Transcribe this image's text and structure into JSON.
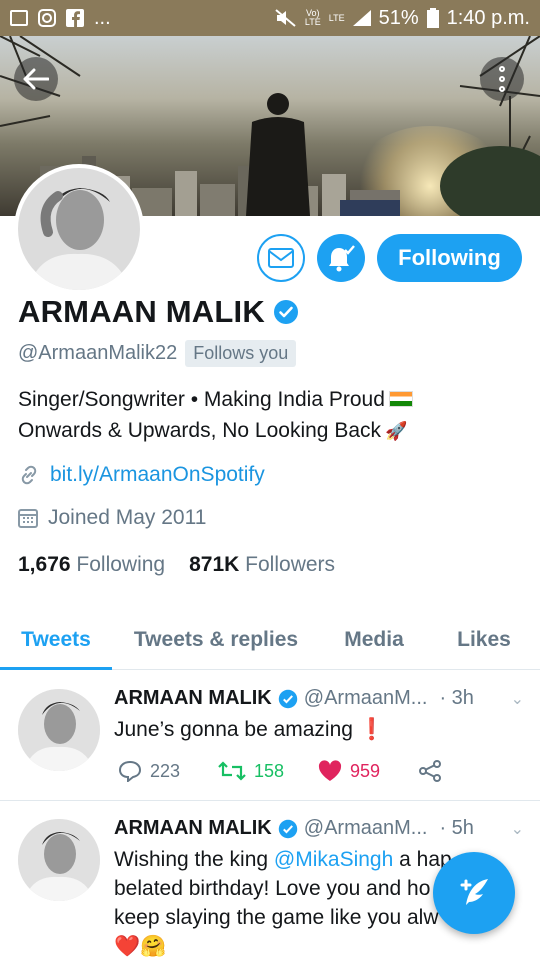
{
  "status_bar": {
    "left_icons": [
      "image-icon",
      "instagram-icon",
      "facebook-icon"
    ],
    "dots": "...",
    "battery": "51%",
    "time": "1:40 p.m.",
    "net_label_1": "Vo)",
    "net_label_2": "LTE",
    "net_label_3": "LTE"
  },
  "profile": {
    "name": "ARMAAN MALIK",
    "handle": "@ArmaanMalik22",
    "follows_you": "Follows you",
    "bio_line1": "Singer/Songwriter • Making India Proud",
    "bio_line2": "Onwards & Upwards, No Looking Back",
    "link": "bit.ly/ArmaanOnSpotify",
    "joined": "Joined May 2011",
    "following_count": "1,676",
    "following_label": "Following",
    "followers_count": "871K",
    "followers_label": "Followers",
    "follow_button": "Following"
  },
  "tabs": [
    {
      "label": "Tweets",
      "active": true
    },
    {
      "label": "Tweets & replies",
      "active": false
    },
    {
      "label": "Media",
      "active": false
    },
    {
      "label": "Likes",
      "active": false
    }
  ],
  "tweets": [
    {
      "name": "ARMAAN MALIK",
      "handle": "@ArmaanM...",
      "time": "· 3h",
      "text": "June’s gonna be amazing ❗",
      "replies": "223",
      "retweets": "158",
      "likes": "959"
    },
    {
      "name": "ARMAAN MALIK",
      "handle": "@ArmaanM...",
      "time": "· 5h",
      "text_pre": "Wishing the king ",
      "mention": "@MikaSingh",
      "text_post": " a hap",
      "line2": "belated birthday! Love you and ho",
      "line3": "keep slaying the game like you alw",
      "line4": "❤️🤗"
    }
  ],
  "colors": {
    "accent": "#1da1f2",
    "retweet": "#17bf63",
    "like": "#e0245e",
    "secondary_text": "#657786"
  }
}
